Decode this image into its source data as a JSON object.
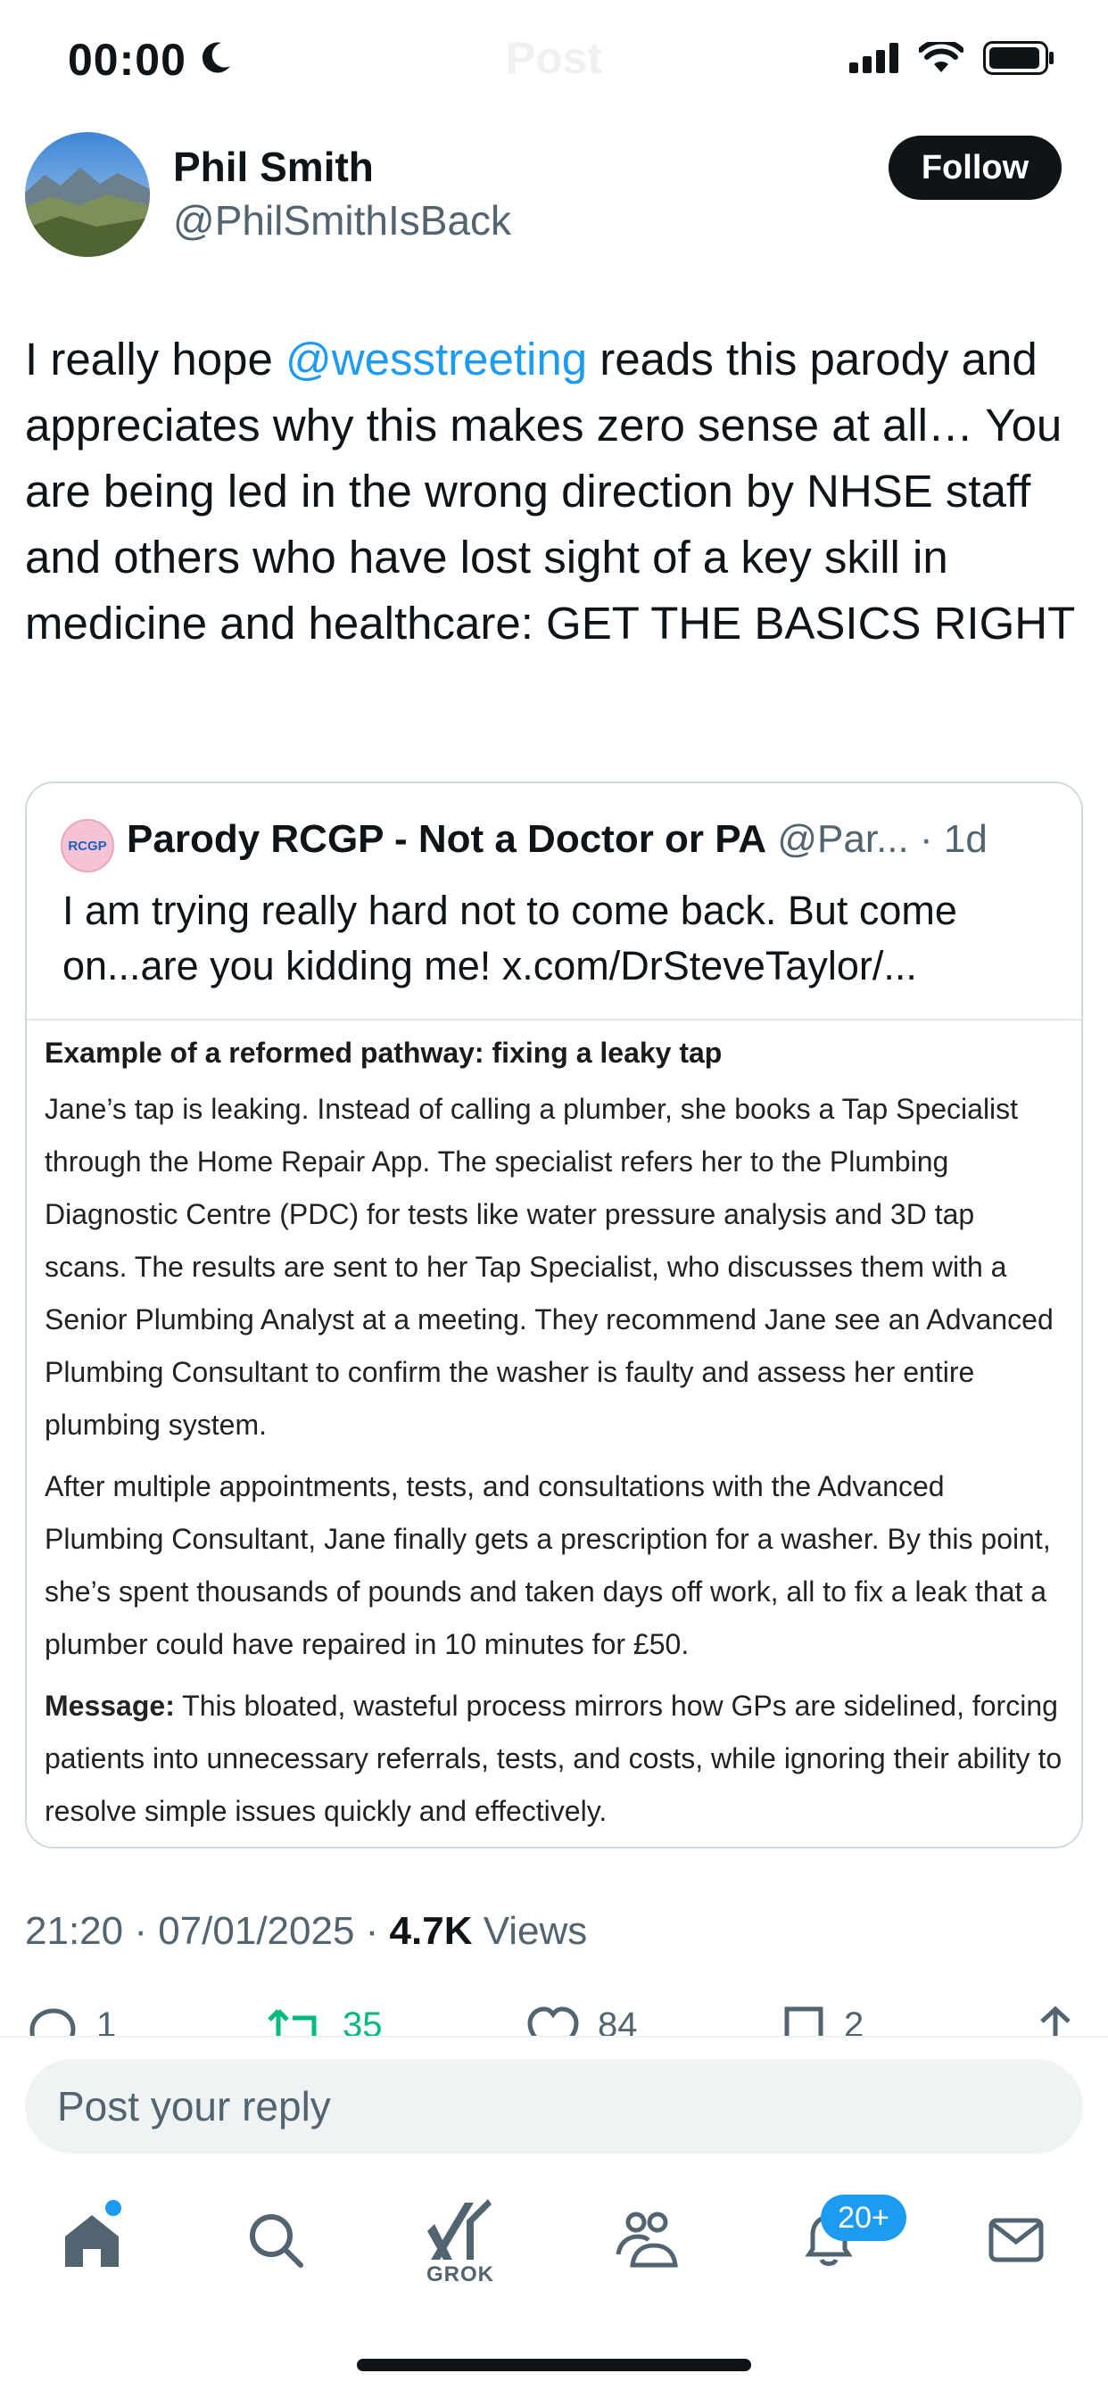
{
  "status_bar": {
    "time": "00:00",
    "ghost_title": "Post"
  },
  "author": {
    "name": "Phil Smith",
    "handle": "@PhilSmithIsBack",
    "follow_label": "Follow"
  },
  "post": {
    "text_before": "I really hope ",
    "mention": "@wesstreeting",
    "text_after": " reads this parody and appreciates why this makes zero sense at all… You are being led in the wrong direction by NHSE staff and others who have lost sight of a key skill in medicine and healthcare: GET THE BASICS RIGHT"
  },
  "quote": {
    "avatar_text": "RCGP",
    "name": "Parody RCGP - Not a Doctor or PA",
    "meta": "@Par... · 1d",
    "text": "I am trying really hard not to come back. But come on...are you kidding me! x.com/DrSteveTaylor/...",
    "image": {
      "heading": "Example of a reformed pathway: fixing a leaky tap",
      "para1": "Jane’s tap is leaking. Instead of calling a plumber, she books a Tap Specialist through the Home Repair App. The specialist refers her to the Plumbing Diagnostic Centre (PDC) for tests like water pressure analysis and 3D tap scans. The results are sent to her Tap Specialist, who discusses them with a Senior Plumbing Analyst at a meeting. They recommend Jane see an Advanced Plumbing Consultant to confirm the washer is faulty and assess her entire plumbing system.",
      "para2": "After multiple appointments, tests, and consultations with the Advanced Plumbing Consultant, Jane finally gets a prescription for a washer. By this point, she’s spent thousands of pounds and taken days off work, all to fix a leak that a plumber could have repaired in 10 minutes for £50.",
      "para3_label": "Message:",
      "para3_text": " This bloated, wasteful process mirrors how GPs are sidelined, forcing patients into unnecessary referrals, tests, and costs, while ignoring their ability to resolve simple issues quickly and effectively."
    }
  },
  "meta": {
    "datetime": "21:20 · 07/01/2025 · ",
    "views_count": "4.7K",
    "views_label": " Views"
  },
  "actions": {
    "replies": "1",
    "reposts": "35",
    "likes": "84",
    "bookmarks": "2"
  },
  "reply_placeholder": "Post your reply",
  "nav": {
    "grok_label": "GROK",
    "notifications_badge": "20+"
  },
  "colors": {
    "accent": "#1d9bf0",
    "repost": "#00ba7c",
    "text": "#0f1419",
    "secondary": "#536471"
  },
  "icons": [
    "moon-icon",
    "signal-icon",
    "wifi-icon",
    "battery-icon",
    "reply-icon",
    "repost-icon",
    "like-icon",
    "bookmark-icon",
    "share-icon",
    "home-icon",
    "search-icon",
    "grok-icon",
    "communities-icon",
    "notifications-icon",
    "messages-icon"
  ]
}
